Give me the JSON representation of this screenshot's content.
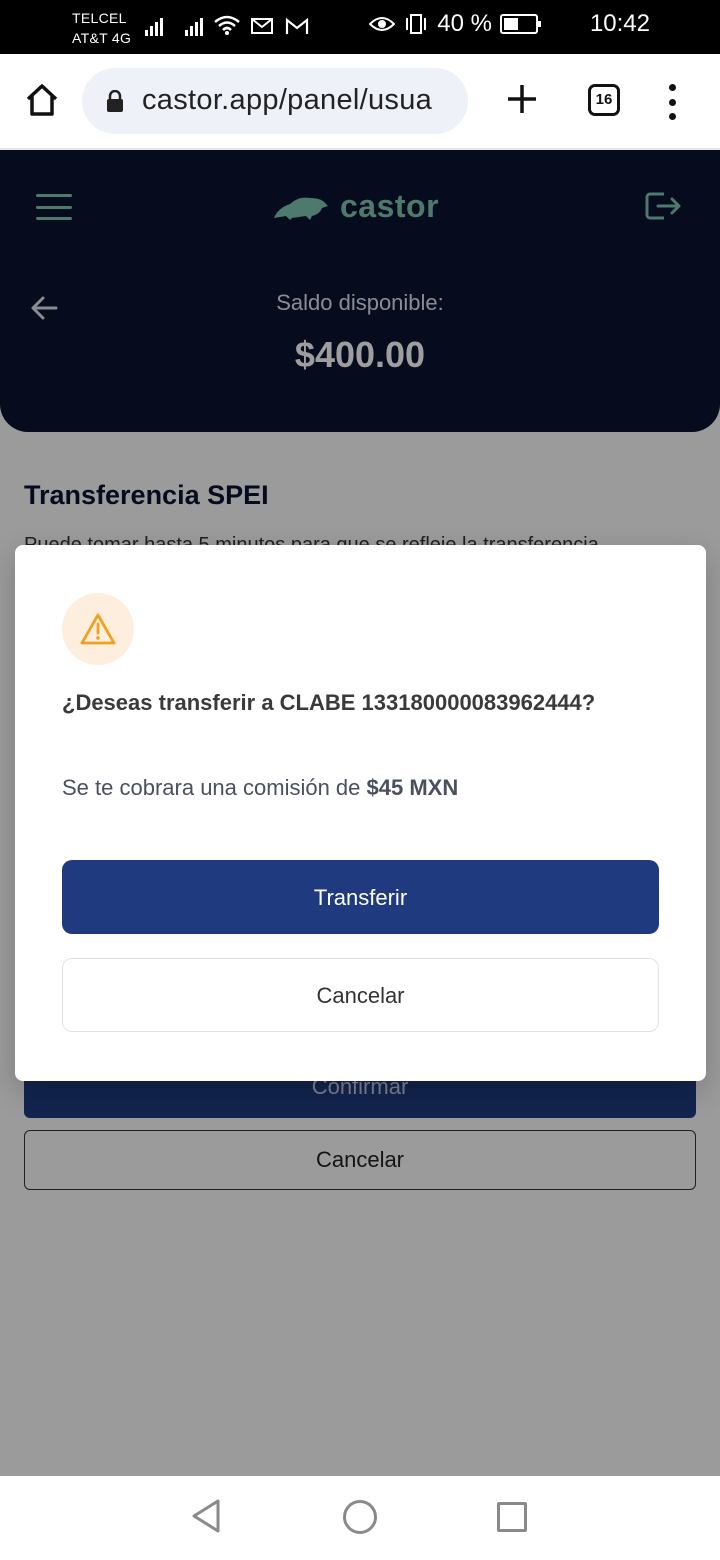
{
  "status_bar": {
    "carrier_line1": "TELCEL",
    "carrier_line2": "AT&T 4G",
    "battery": "40 %",
    "time": "10:42"
  },
  "browser": {
    "url": "castor.app/panel/usua",
    "tab_count": "16"
  },
  "app": {
    "logo_text": "castor",
    "balance_label": "Saldo disponible:",
    "balance_value": "$400.00",
    "section_title": "Transferencia SPEI",
    "section_desc": "Puede tomar hasta 5 minutos para que se refleje la transferencia",
    "confirm_label": "Confirmar",
    "cancel_label": "Cancelar"
  },
  "modal": {
    "title": "¿Deseas transferir a CLABE 133180000083962444?",
    "fee_prefix": "Se te cobrara una comisión de",
    "fee_amount": "$45 MXN",
    "transfer_label": "Transferir",
    "cancel_label": "Cancelar"
  },
  "colors": {
    "header_bg": "#0a1330",
    "brand_green": "#7fc3b0",
    "primary_button": "#1f3a7e",
    "warning": "#f0a020"
  }
}
